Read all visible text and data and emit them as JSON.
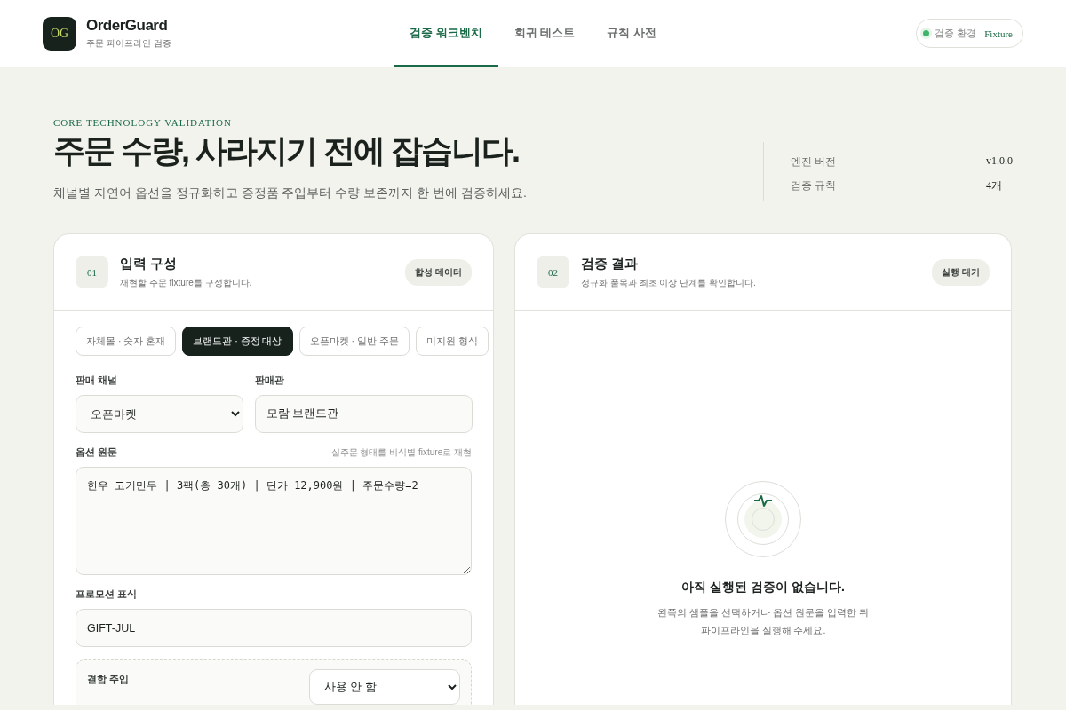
{
  "app": {
    "logo": "OG",
    "name": "OrderGuard",
    "subtitle": "주문 파이프라인 검증"
  },
  "nav": [
    {
      "label": "검증 워크벤치",
      "selected": true
    },
    {
      "label": "회귀 테스트",
      "selected": false
    },
    {
      "label": "규칙 사전",
      "selected": false
    }
  ],
  "environment": {
    "label": "검증 환경",
    "value": "Fixture",
    "on": true
  },
  "hero": {
    "eyebrow": "CORE TECHNOLOGY VALIDATION",
    "title": "주문 수량, 사라지기 전에 잡습니다.",
    "description": "채널별 자연어 옵션을 정규화하고 증정품 주입부터 수량 보존까지 한 번에 검증하세요."
  },
  "stats": [
    {
      "label": "엔진 버전",
      "value": "v1.0.0"
    },
    {
      "label": "검증 규칙",
      "value": "4개"
    }
  ],
  "input_panel": {
    "step": "01",
    "title": "입력 구성",
    "subtitle": "재현할 주문 fixture를 구성합니다.",
    "badge": "합성 데이터",
    "samples": [
      {
        "label": "자체몰 · 숫자 혼재",
        "selected": false
      },
      {
        "label": "브랜드관 · 증정 대상",
        "selected": true
      },
      {
        "label": "오픈마켓 · 일반 주문",
        "selected": false
      },
      {
        "label": "미지원 형식",
        "selected": false
      }
    ],
    "channel": {
      "label": "판매 채널",
      "value": "오픈마켓"
    },
    "store": {
      "label": "판매관",
      "value": "모람 브랜드관"
    },
    "option_text": {
      "label": "옵션 원문",
      "hint": "실주문 형태를 비식별 fixture로 재현",
      "value": "한우 고기만두 | 3팩(총 30개) | 단가 12,900원 | 주문수량=2"
    },
    "promotion": {
      "label": "프로모션 표식",
      "value": "GIFT-JUL"
    },
    "combined_injection": {
      "label": "결합 주입",
      "value": "사용 안 함"
    }
  },
  "result_panel": {
    "step": "02",
    "title": "검증 결과",
    "subtitle": "정규화 품목과 최초 이상 단계를 확인합니다.",
    "badge": "실행 대기",
    "empty_title": "아직 실행된 검증이 없습니다.",
    "empty_message": "왼쪽의 샘플을 선택하거나 옵션 원문을 입력한 뒤 파이프라인을 실행해 주세요."
  }
}
